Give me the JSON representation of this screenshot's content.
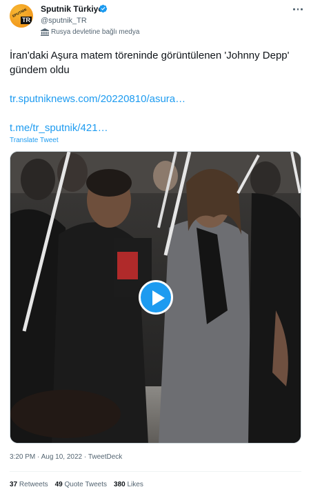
{
  "account": {
    "name": "Sputnik Türkiye",
    "handle": "@sputnik_TR",
    "label": "Rusya devletine bağlı medya",
    "avatar_text": "SPUTNIK",
    "avatar_badge": "TR"
  },
  "tweet": {
    "text": "İran'daki Aşura matem töreninde görüntülenen 'Johnny Depp' gündem oldu",
    "link1": "tr.sputniknews.com/20220810/asura…",
    "link2": "t.me/tr_sputnik/421…",
    "translate_label": "Translate Tweet",
    "time": "3:20 PM",
    "date": "Aug 10, 2022",
    "source": "TweetDeck",
    "separator": " · "
  },
  "stats": {
    "retweets_count": "37",
    "retweets_label": "Retweets",
    "quotes_count": "49",
    "quotes_label": "Quote Tweets",
    "likes_count": "380",
    "likes_label": "Likes"
  },
  "icons": {
    "verified": "verified-badge-icon",
    "state_media": "government-building-icon",
    "more": "more-icon",
    "play": "play-icon"
  },
  "colors": {
    "accent": "#1d9bf0",
    "text": "#0f1419",
    "secondary": "#536471"
  }
}
